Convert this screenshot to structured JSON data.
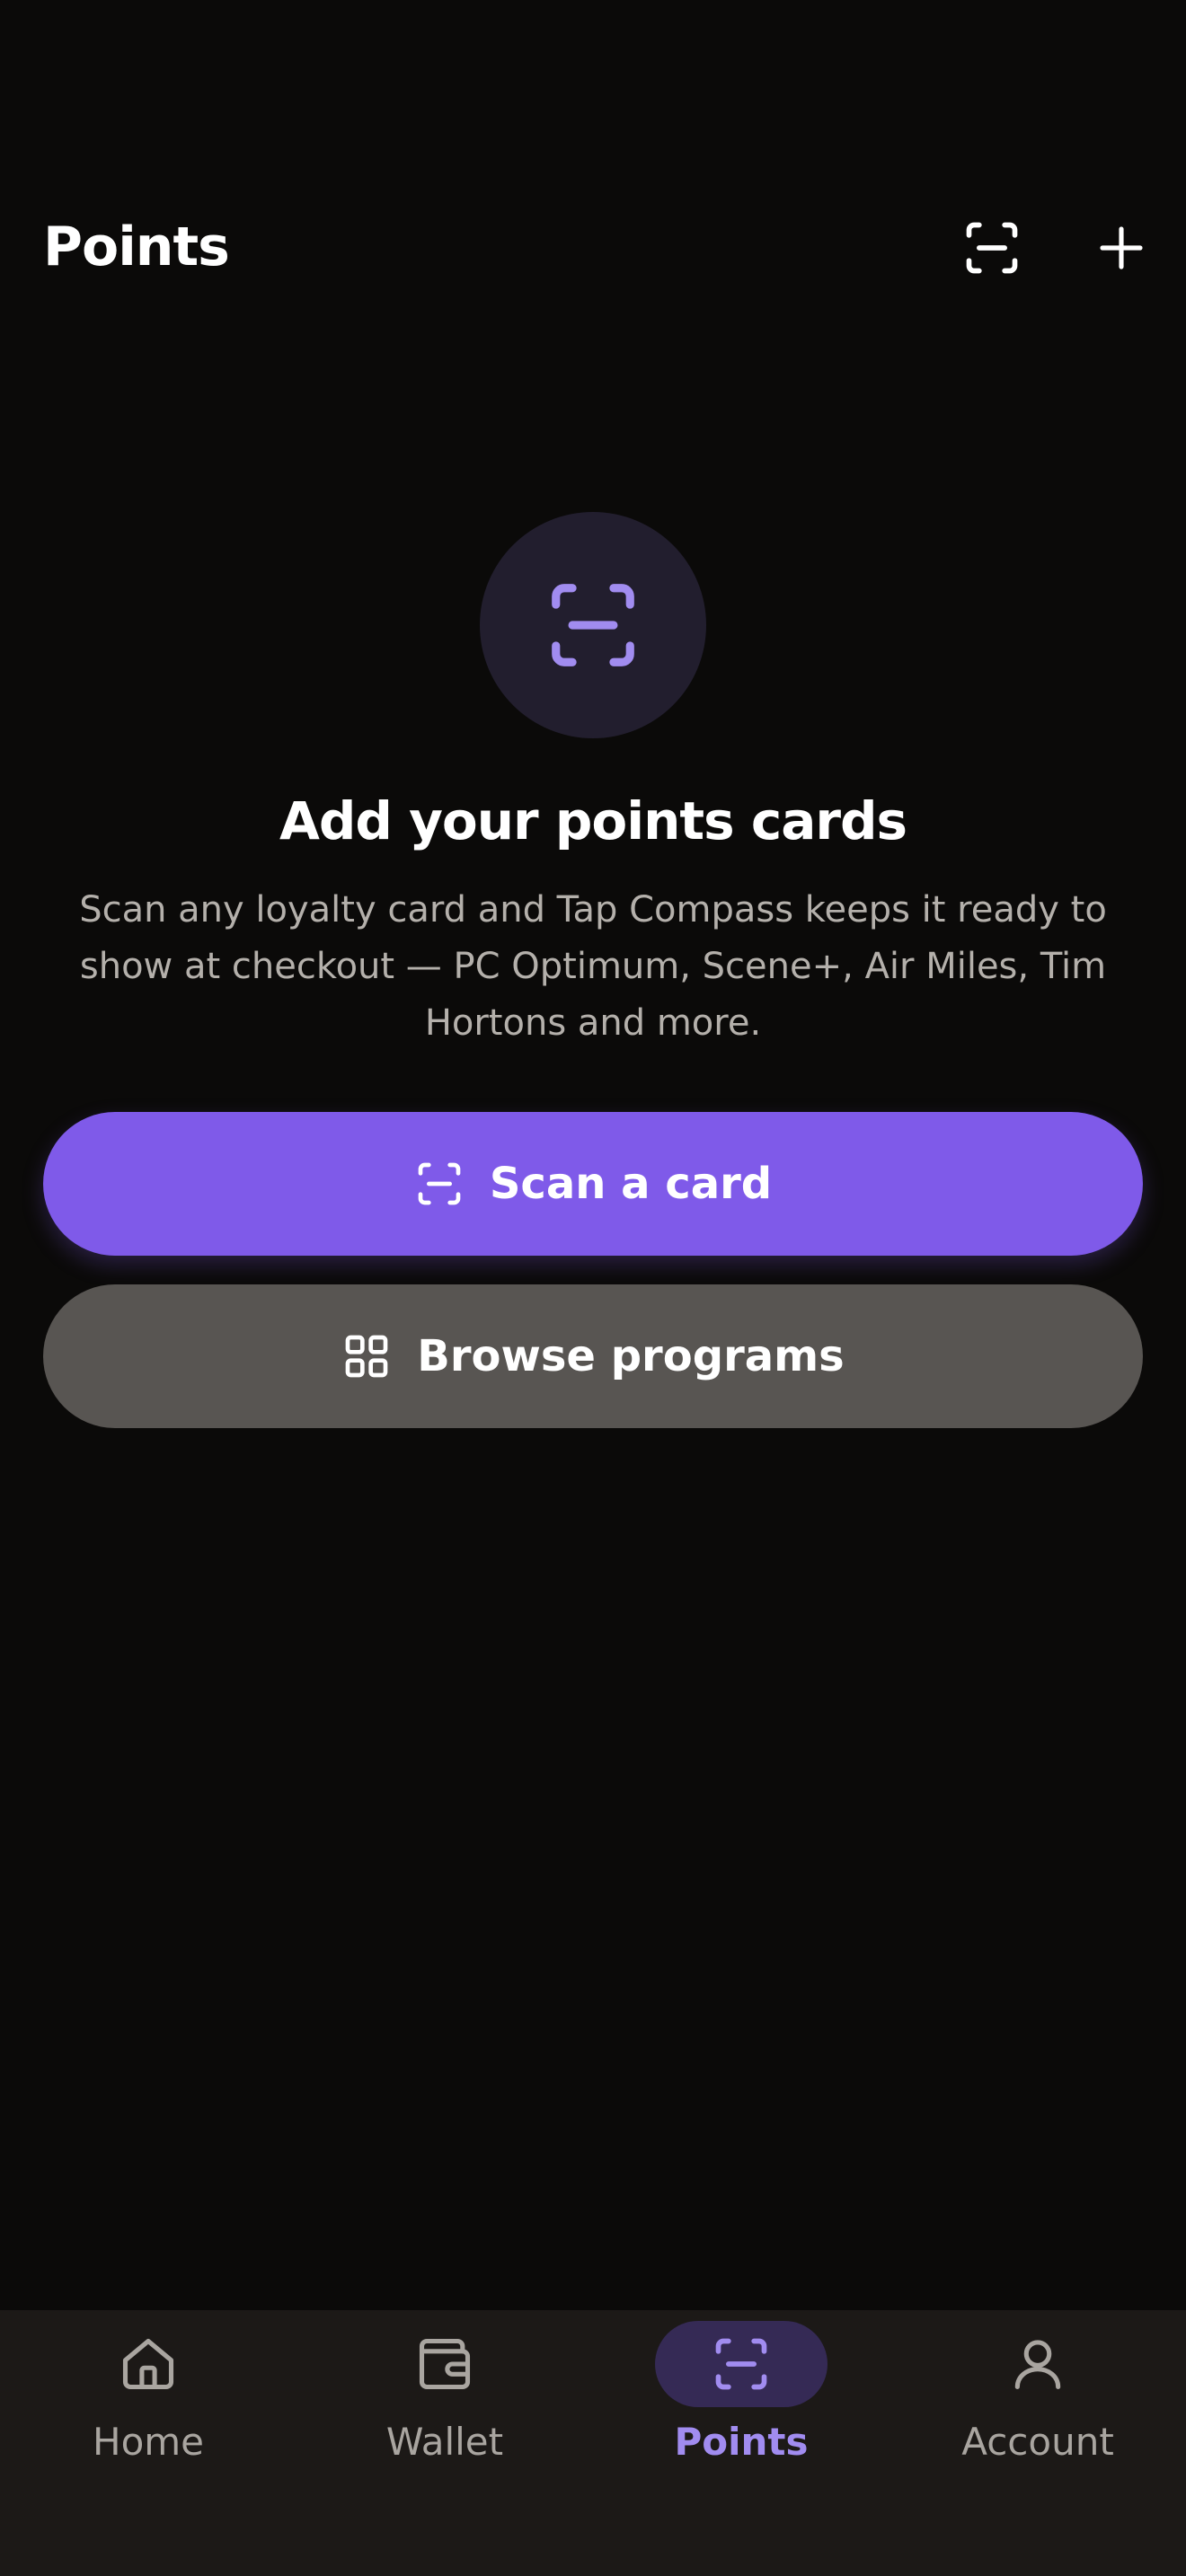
{
  "header": {
    "title": "Points",
    "scan_icon": "scan-icon",
    "add_icon": "plus-icon"
  },
  "empty_state": {
    "icon": "scan-icon",
    "title": "Add your points cards",
    "description": "Scan any loyalty card and Tap Compass keeps it ready to show at checkout — PC Optimum, Scene+, Air Miles, Tim Hortons and more."
  },
  "actions": {
    "scan_label": "Scan a card",
    "scan_icon": "scan-icon",
    "browse_label": "Browse programs",
    "browse_icon": "grid-icon"
  },
  "bottom_nav": {
    "items": [
      {
        "label": "Home",
        "icon": "home-icon",
        "active": false
      },
      {
        "label": "Wallet",
        "icon": "wallet-icon",
        "active": false
      },
      {
        "label": "Points",
        "icon": "scan-icon",
        "active": true
      },
      {
        "label": "Account",
        "icon": "user-icon",
        "active": false
      }
    ]
  },
  "colors": {
    "background": "#0b0a09",
    "accent": "#7f5ae9",
    "accent_light": "#a18cf0",
    "secondary_button": "#585552",
    "nav_background": "#1c1917",
    "muted_text": "#b4b0ab"
  }
}
